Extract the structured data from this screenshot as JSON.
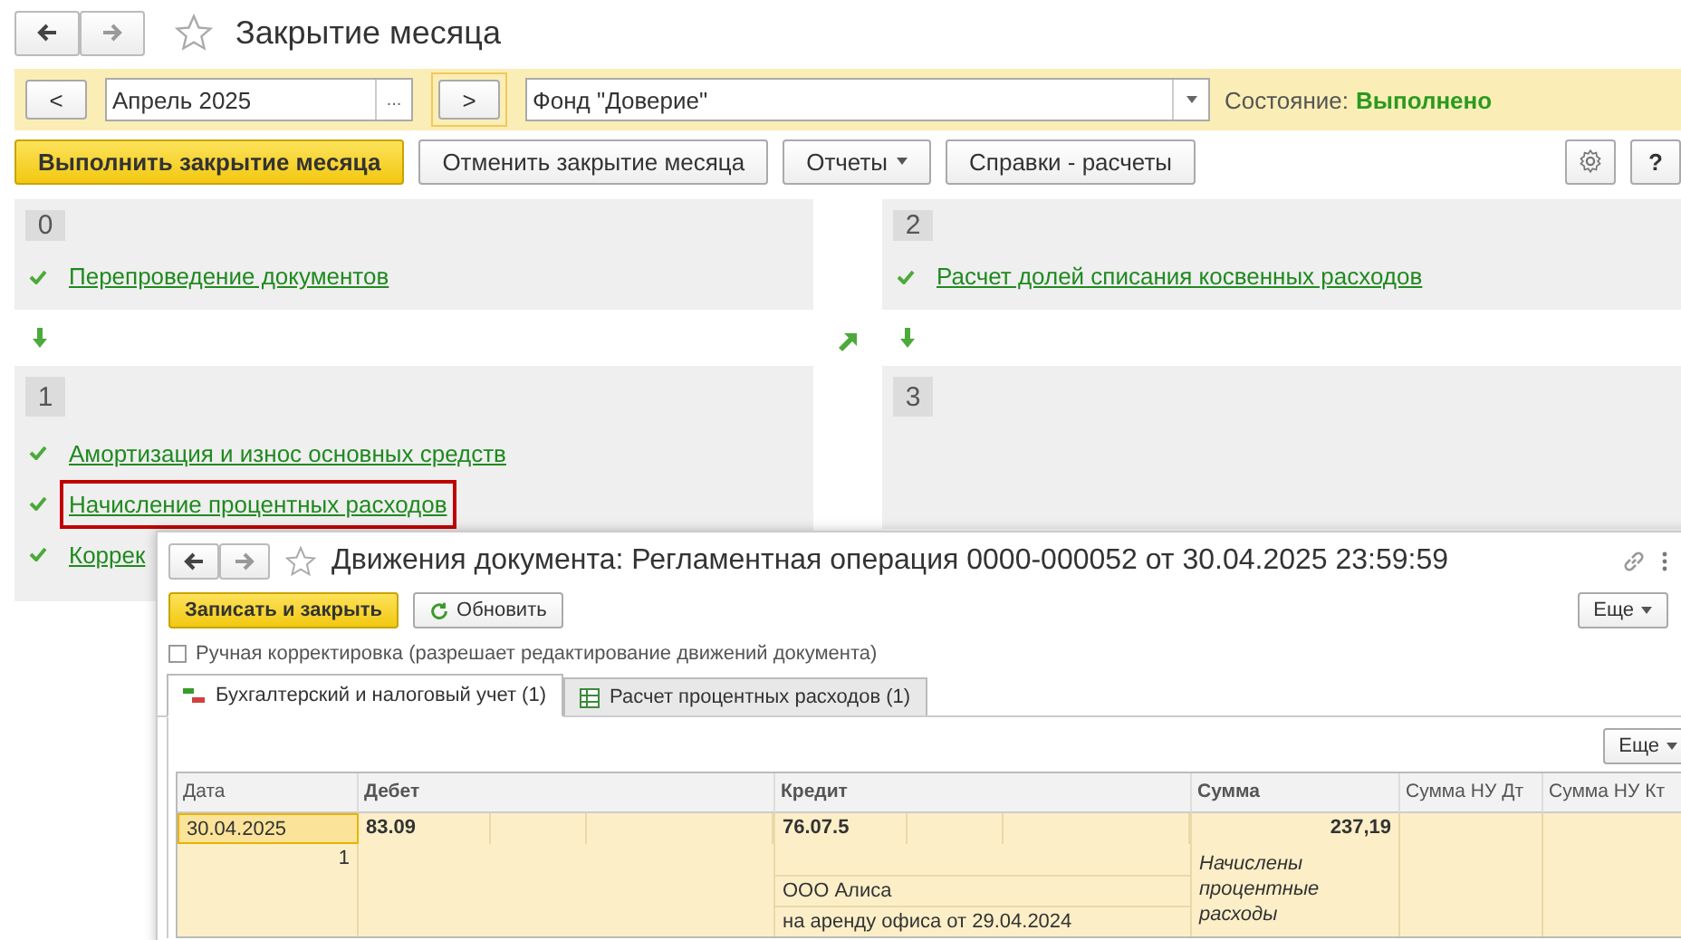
{
  "window": {
    "title": "Закрытие месяца"
  },
  "period_bar": {
    "prev": "<",
    "period": "Апрель 2025",
    "choose": "...",
    "next": ">",
    "organization": "Фонд \"Доверие\"",
    "status_label": "Состояние:",
    "status_value": "Выполнено"
  },
  "toolbar": {
    "buttons": [
      {
        "label": "Выполнить закрытие месяца",
        "kind": "primary"
      },
      {
        "label": "Отменить закрытие месяца",
        "kind": "plain"
      },
      {
        "label": "Отчеты",
        "kind": "menu"
      },
      {
        "label": "Справки - расчеты",
        "kind": "plain"
      }
    ],
    "help": "?"
  },
  "stages": [
    {
      "number": "0",
      "items": [
        {
          "label": "Перепроведение документов",
          "done": true,
          "highlighted": false
        }
      ]
    },
    {
      "number": "1",
      "items": [
        {
          "label": "Амортизация и износ основных средств",
          "done": true,
          "highlighted": false
        },
        {
          "label": "Начисление процентных расходов",
          "done": true,
          "highlighted": true
        },
        {
          "label": "Коррек",
          "done": true,
          "highlighted": false
        }
      ]
    },
    {
      "number": "2",
      "items": [
        {
          "label": "Расчет долей списания косвенных расходов",
          "done": true,
          "highlighted": false
        }
      ]
    },
    {
      "number": "3"
    }
  ],
  "documents_window": {
    "title": "Движения документа: Регламентная операция 0000-000052 от 30.04.2025 23:59:59",
    "buttons": [
      {
        "label": "Записать и закрыть",
        "kind": "primary"
      },
      {
        "label": "Обновить",
        "kind": "refresh"
      }
    ],
    "more": "Еще",
    "manual_edit": {
      "label": "Ручная корректировка (разрешает редактирование движений документа)",
      "checked": false
    },
    "tabs": [
      {
        "label": "Бухгалтерский и налоговый учет (1)",
        "kind": "ledger",
        "selected": true
      },
      {
        "label": "Расчет процентных расходов (1)",
        "kind": "table",
        "selected": false
      }
    ],
    "table_more": "Еще",
    "table": {
      "columns": [
        "Дата",
        "Дебет",
        "Кредит",
        "Сумма",
        "Сумма НУ Дт",
        "Сумма НУ Кт"
      ],
      "rows": [
        {
          "date": "30.04.2025",
          "number": "1",
          "debit": "83.09",
          "credit": "76.07.5",
          "credit_details": [
            "ООО Алиса",
            "на аренду офиса от 29.04.2024"
          ],
          "amount": "237,19",
          "content": "Начислены процентные расходы",
          "selected": true
        }
      ]
    }
  }
}
